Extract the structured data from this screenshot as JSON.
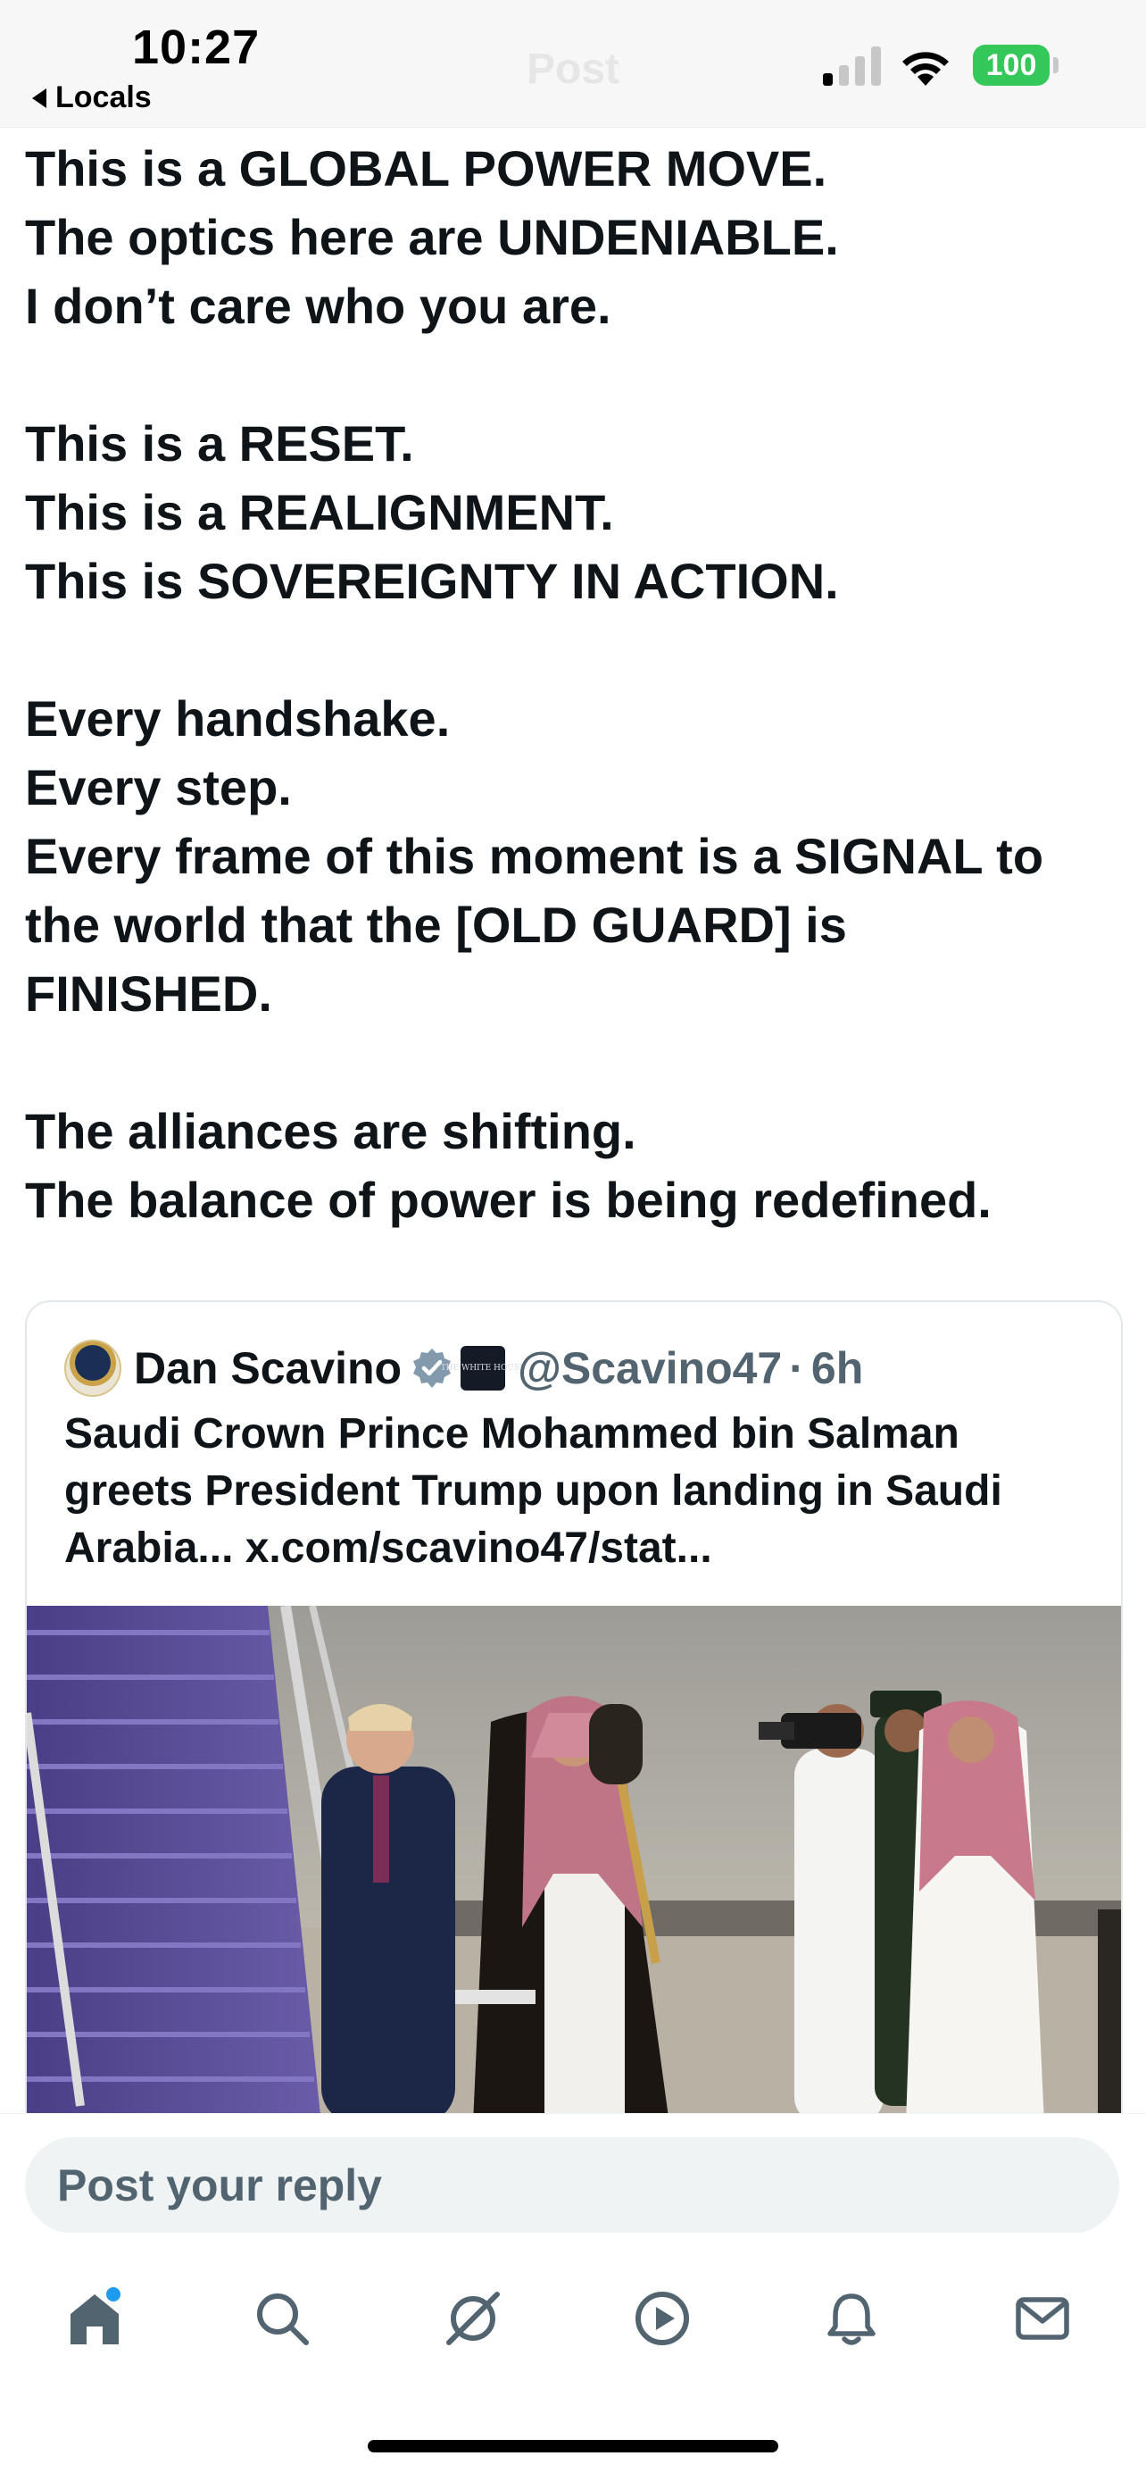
{
  "status_bar": {
    "time": "10:27",
    "back_label": "Locals",
    "battery": "100"
  },
  "header": {
    "title": "Post"
  },
  "post": {
    "lines": [
      "This is a GLOBAL POWER MOVE.",
      "The optics here are UNDENIABLE.",
      "I don’t care who you are.",
      "",
      "This is a RESET.",
      "This is a REALIGNMENT.",
      "This is SOVEREIGNTY IN ACTION.",
      "",
      "Every handshake.",
      "Every step.",
      "Every frame of this moment is a SIGNAL to",
      "the world that the [OLD GUARD] is",
      "FINISHED.",
      "",
      "The alliances are shifting.",
      "The balance of power is being redefined."
    ]
  },
  "quote": {
    "author_name": "Dan Scavino",
    "affiliation_badge": "THE WHITE HOUSE",
    "handle": "@Scavino47",
    "separator": "·",
    "time": "6h",
    "text": "Saudi Crown Prince Mohammed bin Salman greets President Trump upon landing in Saudi Arabia... x.com/scavino47/stat...",
    "media_description_icon": "photo"
  },
  "reply": {
    "placeholder": "Post your reply"
  },
  "tabs": [
    {
      "name": "home",
      "icon": "home-icon",
      "active": true
    },
    {
      "name": "search",
      "icon": "search-icon",
      "active": false
    },
    {
      "name": "grok",
      "icon": "grok-icon",
      "active": false
    },
    {
      "name": "video",
      "icon": "play-icon",
      "active": false
    },
    {
      "name": "notifications",
      "icon": "bell-icon",
      "active": false
    },
    {
      "name": "messages",
      "icon": "mail-icon",
      "active": false
    }
  ],
  "colors": {
    "text": "#0f1419",
    "secondary": "#536471",
    "accent": "#1d9bf0",
    "battery": "#34c759"
  }
}
